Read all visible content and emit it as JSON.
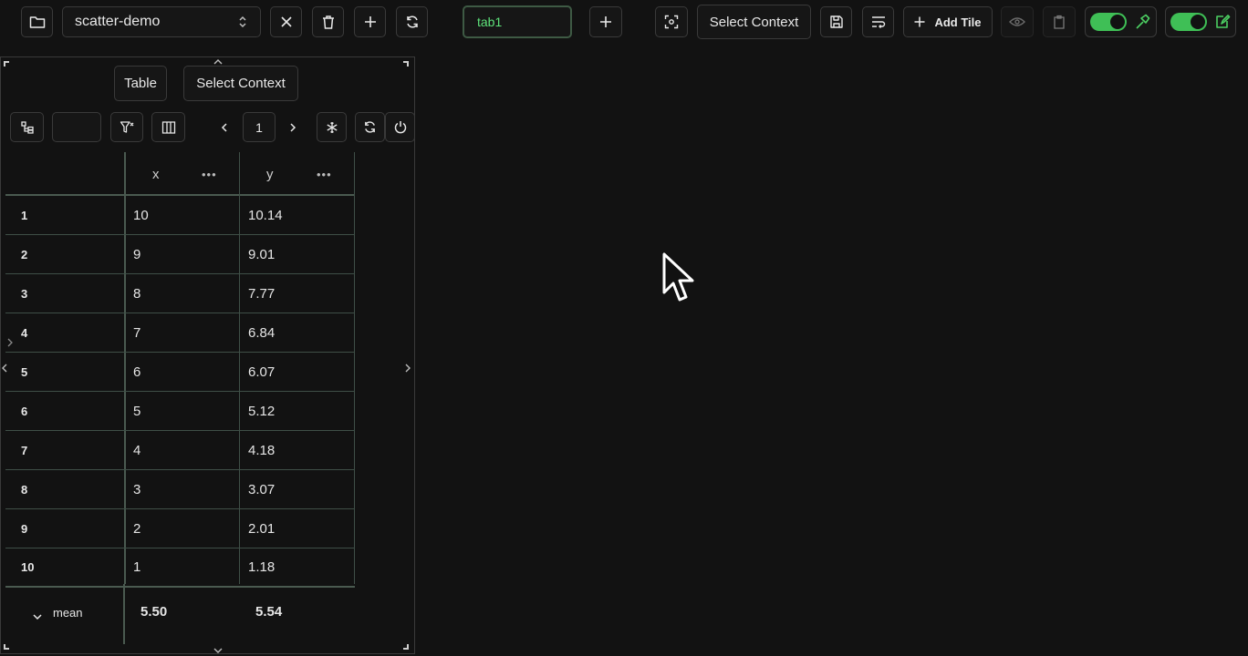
{
  "toolbar": {
    "dashboard_name": "scatter-demo",
    "tab_name": "tab1",
    "select_context_label": "Select Context",
    "add_tile_label": "Add Tile"
  },
  "tile": {
    "table_button_label": "Table",
    "select_context_label": "Select Context",
    "page_number": "1",
    "page_input_value": "",
    "columns": [
      "x",
      "y"
    ],
    "rows": [
      {
        "index": "1",
        "x": "10",
        "y": "10.14"
      },
      {
        "index": "2",
        "x": "9",
        "y": "9.01"
      },
      {
        "index": "3",
        "x": "8",
        "y": "7.77"
      },
      {
        "index": "4",
        "x": "7",
        "y": "6.84"
      },
      {
        "index": "5",
        "x": "6",
        "y": "6.07"
      },
      {
        "index": "6",
        "x": "5",
        "y": "5.12"
      },
      {
        "index": "7",
        "x": "4",
        "y": "4.18"
      },
      {
        "index": "8",
        "x": "3",
        "y": "3.07"
      },
      {
        "index": "9",
        "x": "2",
        "y": "2.01"
      },
      {
        "index": "10",
        "x": "1",
        "y": "1.18"
      }
    ],
    "footer": {
      "label": "mean",
      "x": "5.50",
      "y": "5.54"
    }
  },
  "colors": {
    "background": "#121212",
    "accent_green": "#3fbf56",
    "tab_text": "#5ee37a",
    "border": "#3a3a3a"
  },
  "icons": {
    "folder": "folder-icon",
    "chevron_updown": "chevron-up-down-icon",
    "close": "close-icon",
    "trash": "trash-icon",
    "plus": "plus-icon",
    "refresh": "refresh-icon",
    "screenshot": "screenshot-icon",
    "save": "save-icon",
    "wrap": "wrap-icon",
    "eye": "eye-icon",
    "clipboard": "clipboard-icon",
    "hammer": "hammer-icon",
    "edit": "edit-icon",
    "tree": "tree-icon",
    "filter": "filter-clear-icon",
    "columns": "columns-icon",
    "snowflake": "snowflake-icon",
    "power": "power-icon",
    "pointer": "mouse-pointer-icon"
  }
}
